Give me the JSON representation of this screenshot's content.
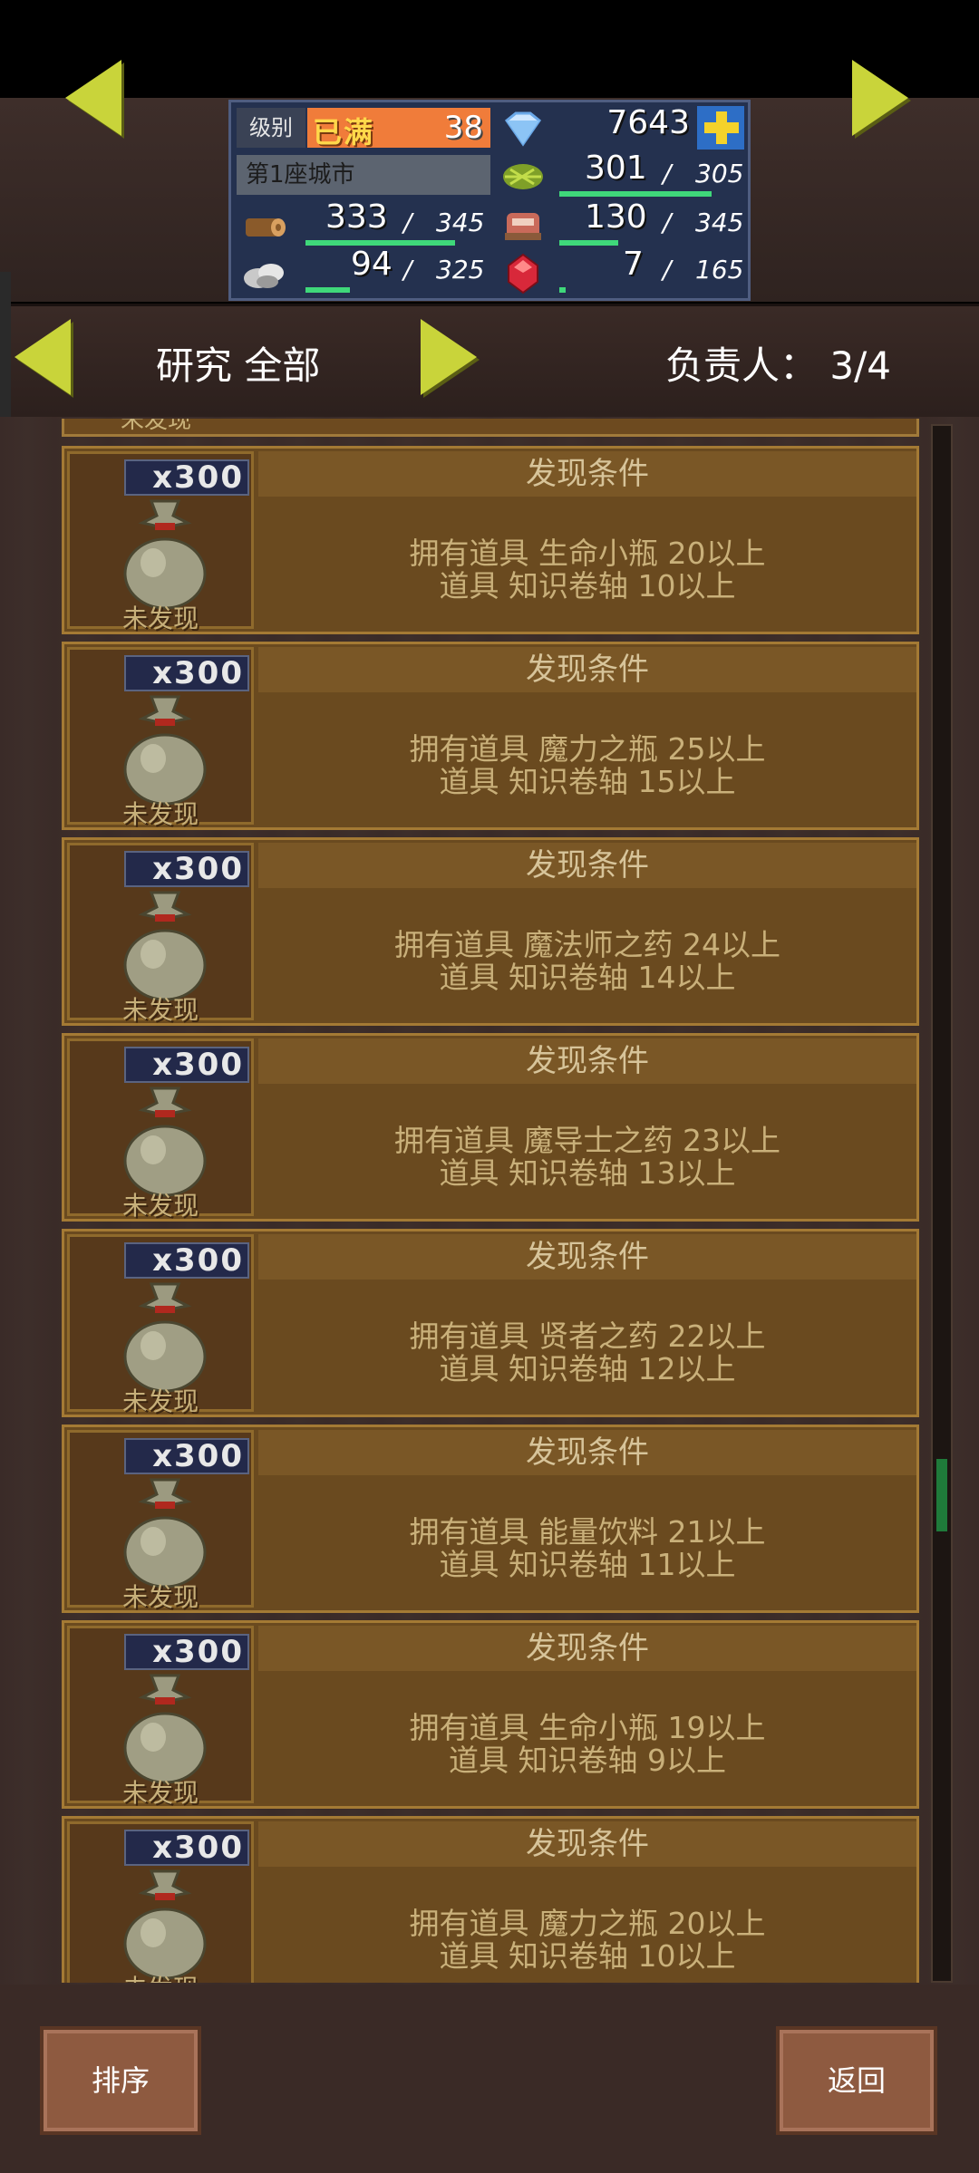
{
  "resources": {
    "level_label": "级别",
    "level_full": "已满",
    "level_value": "38",
    "gems": "7643",
    "city": "第1座城市",
    "food": {
      "value": "301",
      "max": "305",
      "fill": 0.99
    },
    "wood": {
      "value": "333",
      "max": "345",
      "fill": 0.97
    },
    "meat": {
      "value": "130",
      "max": "345",
      "fill": 0.38
    },
    "stone": {
      "value": "94",
      "max": "325",
      "fill": 0.29
    },
    "ruby": {
      "value": "7",
      "max": "165",
      "fill": 0.04
    },
    "separator": "/"
  },
  "header": {
    "title": "研究 全部",
    "responsible": "负责人： 3/4"
  },
  "list": {
    "partial_label": "未发现",
    "cards": [
      {
        "qty": "x300",
        "status": "未发现",
        "cond_title": "发现条件",
        "line1": "拥有道具 生命小瓶 20以上",
        "line2": "道具 知识卷轴 10以上"
      },
      {
        "qty": "x300",
        "status": "未发现",
        "cond_title": "发现条件",
        "line1": "拥有道具 魔力之瓶 25以上",
        "line2": "道具 知识卷轴 15以上"
      },
      {
        "qty": "x300",
        "status": "未发现",
        "cond_title": "发现条件",
        "line1": "拥有道具 魔法师之药 24以上",
        "line2": "道具 知识卷轴 14以上"
      },
      {
        "qty": "x300",
        "status": "未发现",
        "cond_title": "发现条件",
        "line1": "拥有道具 魔导士之药 23以上",
        "line2": "道具 知识卷轴 13以上"
      },
      {
        "qty": "x300",
        "status": "未发现",
        "cond_title": "发现条件",
        "line1": "拥有道具 贤者之药 22以上",
        "line2": "道具 知识卷轴 12以上"
      },
      {
        "qty": "x300",
        "status": "未发现",
        "cond_title": "发现条件",
        "line1": "拥有道具 能量饮料 21以上",
        "line2": "道具 知识卷轴 11以上"
      },
      {
        "qty": "x300",
        "status": "未发现",
        "cond_title": "发现条件",
        "line1": "拥有道具 生命小瓶 19以上",
        "line2": "道具 知识卷轴 9以上"
      },
      {
        "qty": "x300",
        "status": "未发现",
        "cond_title": "发现条件",
        "line1": "拥有道具 魔力之瓶 20以上",
        "line2": "道具 知识卷轴 10以上"
      }
    ]
  },
  "buttons": {
    "sort": "排序",
    "back": "返回"
  },
  "colors": {
    "accent_arrow": "#c9d43a",
    "bar_fill": "#3fd87a"
  }
}
